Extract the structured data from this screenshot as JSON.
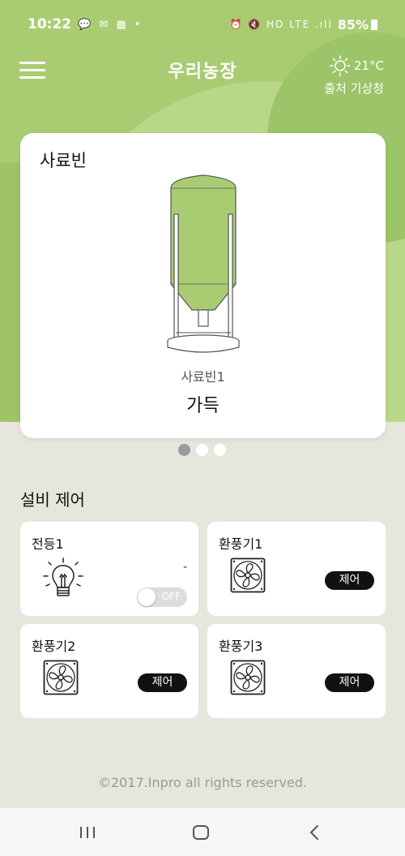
{
  "status_bar": {
    "time": "10:22",
    "left_icons": "💬 ✉ ▦ •",
    "right_icons": "⏰ 🔇 HD LTE .ıll",
    "battery": "85%"
  },
  "app_bar": {
    "title": "우리농장",
    "weather": {
      "temp": "21°C",
      "source": "출처 기상청",
      "icon": "sun-icon"
    }
  },
  "bin_card": {
    "title": "사료빈",
    "silo_name": "사료빈1",
    "silo_state": "가득",
    "fill_level": 1.0,
    "fill_color": "#a9cc73",
    "page_count": 3,
    "active_page": 1
  },
  "equipment": {
    "section_title": "설비 제어",
    "devices": [
      {
        "title": "전등1",
        "icon": "lightbulb-icon",
        "value": "-",
        "toggle": "OFF"
      },
      {
        "title": "환풍기1",
        "icon": "fan-icon",
        "button": "제어"
      },
      {
        "title": "환풍기2",
        "icon": "fan-icon",
        "button": "제어"
      },
      {
        "title": "환풍기3",
        "icon": "fan-icon",
        "button": "제어"
      }
    ]
  },
  "footer": {
    "copyright": "©2017.Inpro all rights reserved."
  },
  "nav_bar": {
    "icons": [
      "recents-icon",
      "home-icon",
      "back-icon"
    ]
  },
  "colors": {
    "brand_green": "#a9cc73",
    "background": "#e6e6dd"
  }
}
